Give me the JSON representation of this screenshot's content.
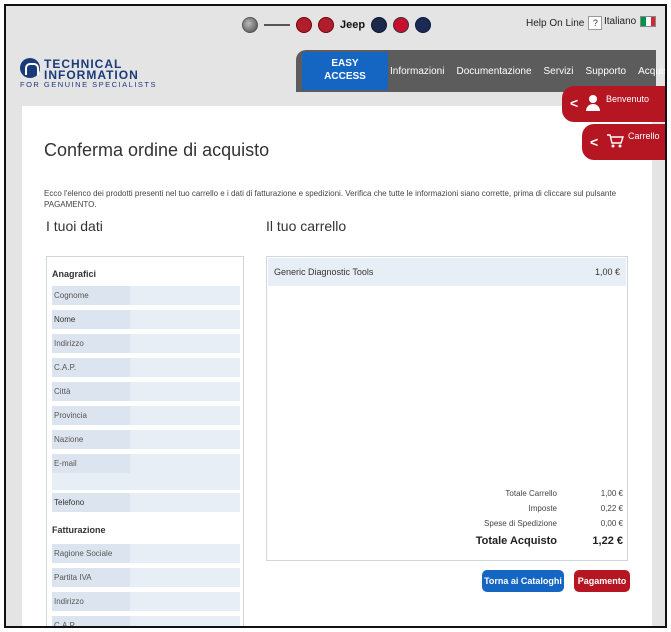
{
  "top": {
    "brands": [
      "Alfa Romeo",
      "Lancia",
      "Fiat",
      "Fiat Professional",
      "Jeep",
      "Chrysler",
      "Abarth",
      "Mopar"
    ],
    "jeep_label": "Jeep",
    "help_label": "Help On Line",
    "help_icon": "?",
    "language_label": "Italiano",
    "flag_colors": [
      "#009246",
      "#ffffff",
      "#ce2b37"
    ]
  },
  "logo": {
    "line1": "TECHNICAL",
    "line2": "INFORMATION",
    "tagline": "FOR GENUINE SPECIALISTS",
    "color": "#1a3a7a"
  },
  "nav": {
    "easy_line1": "EASY",
    "easy_line2": "ACCESS",
    "items": [
      "Informazioni",
      "Documentazione",
      "Servizi",
      "Supporto",
      "Acquista"
    ]
  },
  "side": {
    "benvenuto": "Benvenuto",
    "carrello": "Carrello"
  },
  "page": {
    "title": "Conferma ordine di acquisto",
    "intro": "Ecco l'elenco dei prodotti presenti nel tuo carrello e i dati di fatturazione e spedizioni. Verifica che tutte le informazioni siano corrette, prima di cliccare sul pulsante PAGAMENTO.",
    "dati_heading": "I tuoi dati",
    "carrello_heading": "Il tuo carrello"
  },
  "dati": {
    "anagrafici_title": "Anagrafici",
    "anagrafici": [
      "Cognome",
      "Nome",
      "Indirizzo",
      "C.A.P.",
      "Città",
      "Provincia",
      "Nazione",
      "E-mail",
      "Telefono"
    ],
    "fatturazione_title": "Fatturazione",
    "fatturazione": [
      "Ragione Sociale",
      "Partita IVA",
      "Indirizzo",
      "C.A.P."
    ]
  },
  "carrello": {
    "items": [
      {
        "name": "Generic Diagnostic Tools",
        "price": "1,00 €"
      }
    ],
    "totals": [
      {
        "label": "Totale Carrello",
        "value": "1,00 €"
      },
      {
        "label": "Imposte",
        "value": "0,22 €"
      },
      {
        "label": "Spese di Spedizione",
        "value": "0,00 €"
      }
    ],
    "grand_total_label": "Totale Acquisto",
    "grand_total_value": "1,22 €"
  },
  "buttons": {
    "cataloghi": "Torna ai Cataloghi",
    "pagamento": "Pagamento"
  }
}
